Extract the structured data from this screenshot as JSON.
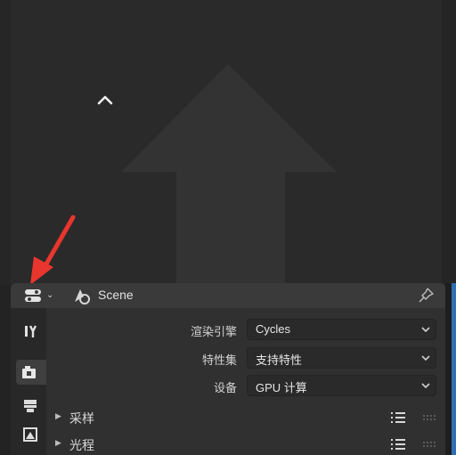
{
  "viewport": {
    "collapse_icon": "chevron-up-icon",
    "overlay_icon": "large-up-arrow-icon"
  },
  "annotation": {
    "icon": "red-pointer-arrow",
    "color": "#e8362e"
  },
  "properties": {
    "header": {
      "editor_type_icon": "properties-editor-icon",
      "scene_icon": "scene-icon",
      "title": "Scene",
      "pin_icon": "pin-icon"
    },
    "tabs": [
      {
        "name": "tool",
        "icon": "tool-icon",
        "active": false
      },
      {
        "name": "render",
        "icon": "render-camera-icon",
        "active": true
      },
      {
        "name": "output",
        "icon": "output-printer-icon",
        "active": false
      },
      {
        "name": "view-layer",
        "icon": "view-layer-icon",
        "active": false
      }
    ],
    "rows": [
      {
        "label": "渲染引擎",
        "value": "Cycles"
      },
      {
        "label": "特性集",
        "value": "支持特性"
      },
      {
        "label": "设备",
        "value": "GPU 计算"
      }
    ],
    "panels": [
      {
        "title": "采样"
      },
      {
        "title": "光程"
      }
    ]
  },
  "colors": {
    "accent_blue": "#2f6fb3",
    "panel_bg": "#303030",
    "header_bg": "#3a3a3a"
  }
}
